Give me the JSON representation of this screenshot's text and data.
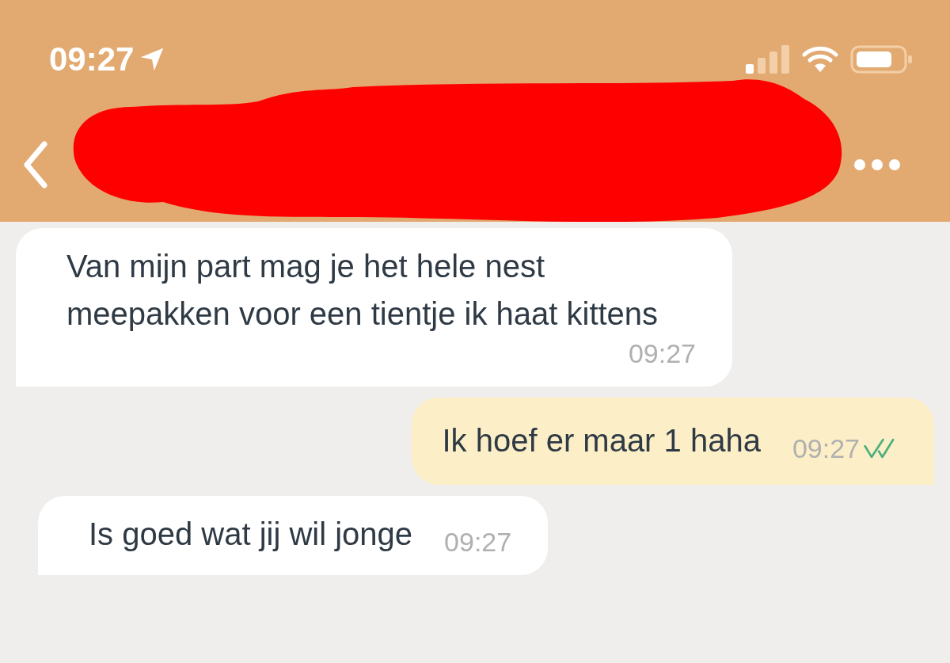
{
  "status_bar": {
    "time": "09:27"
  },
  "messages": [
    {
      "kind": "incoming",
      "text": "Van mijn part mag je het hele nest meepakken voor een tientje ik haat kittens",
      "time": "09:27"
    },
    {
      "kind": "outgoing",
      "text": "Ik hoef er maar 1 haha",
      "time": "09:27",
      "read": true
    },
    {
      "kind": "incoming",
      "text": "Is goed wat jij wil jonge",
      "time": "09:27"
    }
  ]
}
